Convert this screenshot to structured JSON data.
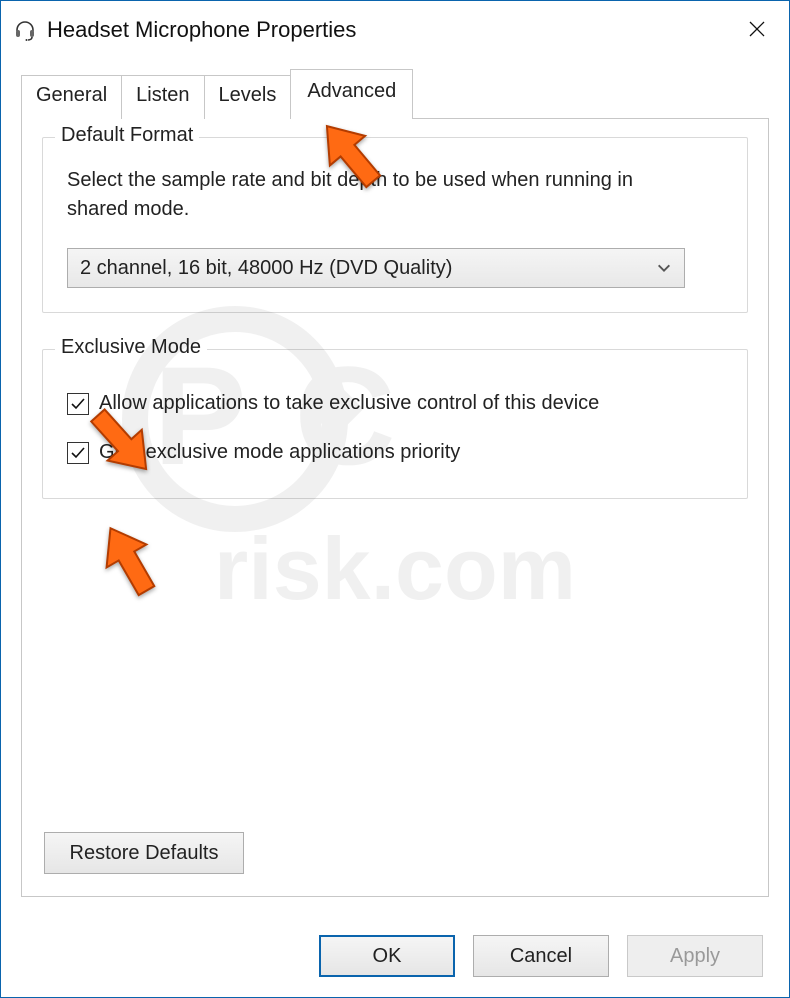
{
  "window": {
    "title": "Headset Microphone Properties"
  },
  "tabs": {
    "items": [
      {
        "label": "General",
        "active": false
      },
      {
        "label": "Listen",
        "active": false
      },
      {
        "label": "Levels",
        "active": false
      },
      {
        "label": "Advanced",
        "active": true
      }
    ]
  },
  "defaultFormat": {
    "legend": "Default Format",
    "description": "Select the sample rate and bit depth to be used when running in shared mode.",
    "selected": "2 channel, 16 bit, 48000 Hz (DVD Quality)"
  },
  "exclusive": {
    "legend": "Exclusive Mode",
    "option1": {
      "label": "Allow applications to take exclusive control of this device",
      "checked": true
    },
    "option2": {
      "label": "Give exclusive mode applications priority",
      "checked": true
    }
  },
  "buttons": {
    "restore": "Restore Defaults",
    "ok": "OK",
    "cancel": "Cancel",
    "apply": "Apply"
  },
  "watermark": {
    "text": "PCrisk.com"
  },
  "annotation": {
    "arrow_color_fill": "#ff6a13",
    "arrow_color_stroke": "#b33c00"
  }
}
